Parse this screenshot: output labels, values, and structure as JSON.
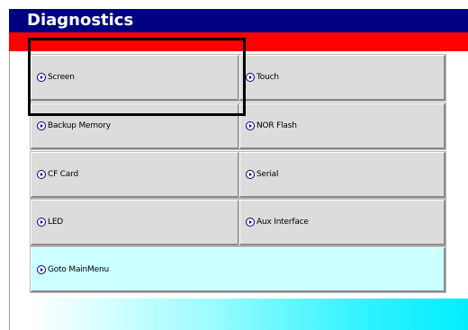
{
  "header": {
    "title": "Diagnostics"
  },
  "menu": {
    "screen": "Screen",
    "touch": "Touch",
    "backup_memory": "Backup Memory",
    "nor_flash": "NOR Flash",
    "cf_card": "CF Card",
    "serial": "Serial",
    "led": "LED",
    "aux_interface": "Aux Interface",
    "goto_mainmenu": "Goto MainMenu"
  },
  "colors": {
    "title_bar": "#000080",
    "band": "#ff0000",
    "button_face": "#dcdcdc",
    "main_menu_button": "#ccffff",
    "highlight_box": "#000000"
  },
  "icons": {
    "button_bullet": "circle-arrow-right-icon"
  }
}
